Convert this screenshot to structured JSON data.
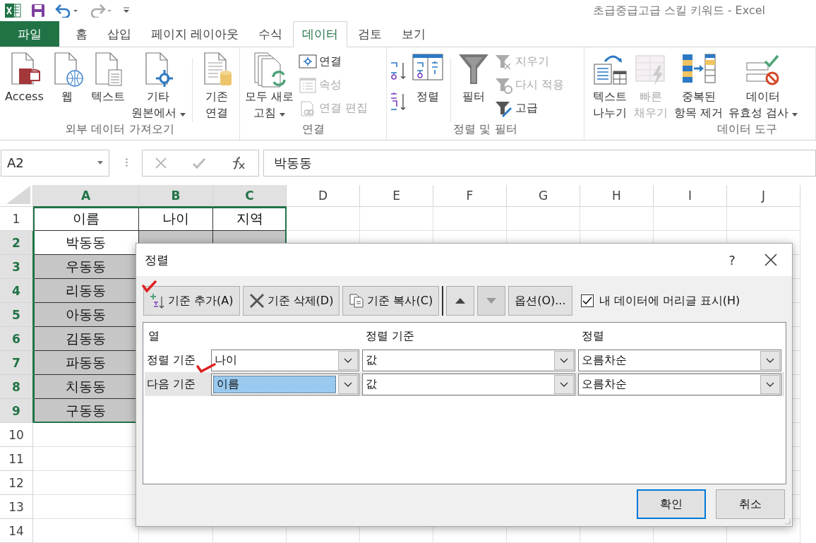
{
  "title_bar": {
    "title": "초급중급고급 스킬 키워드 - Excel"
  },
  "ribbon_tabs": [
    {
      "label": "파일",
      "kind": "file"
    },
    {
      "label": "홈",
      "kind": "tab",
      "selected": false
    },
    {
      "label": "삽입",
      "kind": "tab",
      "selected": false
    },
    {
      "label": "페이지 레이아웃",
      "kind": "tab",
      "selected": false
    },
    {
      "label": "수식",
      "kind": "tab",
      "selected": false
    },
    {
      "label": "데이터",
      "kind": "tab",
      "selected": true
    },
    {
      "label": "검토",
      "kind": "tab",
      "selected": false
    },
    {
      "label": "보기",
      "kind": "tab",
      "selected": false
    }
  ],
  "ribbon_groups": [
    {
      "label": "외부 데이터 가져오기",
      "items": [
        {
          "kind": "large",
          "lines": [
            "Access"
          ],
          "dropdown": false,
          "disabled": false
        },
        {
          "kind": "large",
          "lines": [
            "웹"
          ],
          "dropdown": false,
          "disabled": false
        },
        {
          "kind": "large",
          "lines": [
            "텍스트"
          ],
          "dropdown": false,
          "disabled": false
        },
        {
          "kind": "large",
          "lines": [
            "기타",
            "원본에서"
          ],
          "dropdown": true,
          "disabled": false
        },
        {
          "kind": "separator"
        },
        {
          "kind": "large",
          "lines": [
            "기존",
            "연결"
          ],
          "dropdown": false,
          "disabled": false
        }
      ]
    },
    {
      "label": "연결",
      "items": [
        {
          "kind": "large",
          "lines": [
            "모두 새로",
            "고침"
          ],
          "dropdown": true,
          "disabled": false
        },
        {
          "kind": "stack",
          "buttons": [
            {
              "label": "연결",
              "disabled": false
            },
            {
              "label": "속성",
              "disabled": true
            },
            {
              "label": "연결 편집",
              "disabled": true
            }
          ]
        }
      ]
    },
    {
      "label": "정렬 및 필터",
      "items": [
        {
          "kind": "icons"
        },
        {
          "kind": "large",
          "lines": [
            "정렬"
          ],
          "dropdown": false,
          "disabled": false
        },
        {
          "kind": "separator"
        },
        {
          "kind": "large",
          "lines": [
            "필터"
          ],
          "dropdown": false,
          "disabled": false
        },
        {
          "kind": "stack",
          "buttons": [
            {
              "label": "지우기",
              "disabled": true
            },
            {
              "label": "다시 적용",
              "disabled": true
            },
            {
              "label": "고급",
              "disabled": false
            }
          ]
        }
      ]
    },
    {
      "label": "데이터 도구",
      "items": [
        {
          "kind": "large",
          "lines": [
            "텍스트",
            "나누기"
          ],
          "dropdown": false,
          "disabled": false
        },
        {
          "kind": "large",
          "lines": [
            "빠른",
            "채우기"
          ],
          "dropdown": false,
          "disabled": true
        },
        {
          "kind": "large",
          "lines": [
            "중복된",
            "항목 제거"
          ],
          "dropdown": false,
          "disabled": false
        },
        {
          "kind": "large",
          "lines": [
            "데이터",
            "유효성 검사"
          ],
          "dropdown": true,
          "disabled": false
        }
      ]
    }
  ],
  "formula_bar": {
    "name_box": "A2",
    "value": "박동동"
  },
  "sheet": {
    "columns": [
      {
        "label": "A",
        "selected": true
      },
      {
        "label": "B",
        "selected": true
      },
      {
        "label": "C",
        "selected": true
      },
      {
        "label": "D",
        "selected": false
      },
      {
        "label": "E",
        "selected": false
      },
      {
        "label": "F",
        "selected": false
      },
      {
        "label": "G",
        "selected": false
      },
      {
        "label": "H",
        "selected": false
      },
      {
        "label": "I",
        "selected": false
      },
      {
        "label": "J",
        "selected": false
      }
    ],
    "rows": [
      {
        "label": "1",
        "selected": false,
        "cells": [
          {
            "text": "이름",
            "selected": false
          },
          {
            "text": "나이",
            "selected": false
          },
          {
            "text": "지역",
            "selected": false
          }
        ]
      },
      {
        "label": "2",
        "selected": true,
        "cells": [
          {
            "text": "박동동",
            "selected": false
          },
          {
            "selected": true
          },
          {
            "selected": true
          }
        ]
      },
      {
        "label": "3",
        "selected": true,
        "cells": [
          {
            "text": "우동동",
            "selected": true
          }
        ]
      },
      {
        "label": "4",
        "selected": true,
        "cells": [
          {
            "text": "리동동",
            "selected": true
          }
        ]
      },
      {
        "label": "5",
        "selected": true,
        "cells": [
          {
            "text": "아동동",
            "selected": true
          }
        ]
      },
      {
        "label": "6",
        "selected": true,
        "cells": [
          {
            "text": "김동동",
            "selected": true
          }
        ]
      },
      {
        "label": "7",
        "selected": true,
        "cells": [
          {
            "text": "파동동",
            "selected": true
          }
        ]
      },
      {
        "label": "8",
        "selected": true,
        "cells": [
          {
            "text": "치동동",
            "selected": true
          }
        ]
      },
      {
        "label": "9",
        "selected": true,
        "cells": [
          {
            "text": "구동동",
            "selected": true
          }
        ]
      },
      {
        "label": "10",
        "selected": false,
        "cells": []
      },
      {
        "label": "11",
        "selected": false,
        "cells": []
      },
      {
        "label": "12",
        "selected": false,
        "cells": []
      },
      {
        "label": "13",
        "selected": false,
        "cells": []
      },
      {
        "label": "14",
        "selected": false,
        "cells": []
      }
    ]
  },
  "dialog": {
    "title": "정렬",
    "help": "?",
    "toolbar": [
      {
        "label": "기준 추가(A)",
        "kind": "add"
      },
      {
        "label": "기준 삭제(D)",
        "kind": "delete"
      },
      {
        "label": "기준 복사(C)",
        "kind": "copy"
      },
      {
        "kind": "up",
        "disabled": false
      },
      {
        "kind": "down",
        "disabled": true
      },
      {
        "label": "옵션(O)...",
        "kind": "plain"
      }
    ],
    "header_checkbox": {
      "label": "내 데이터에 머리글 표시(H)",
      "checked": true
    },
    "headers": [
      "열",
      "정렬 기준",
      "정렬"
    ],
    "levels": [
      {
        "label": "정렬 기준",
        "column": "나이",
        "sort_on": "값",
        "order": "오름차순",
        "selected": false
      },
      {
        "label": "다음 기준",
        "column": "이름",
        "sort_on": "값",
        "order": "오름차순",
        "selected": true
      }
    ],
    "buttons": [
      "확인",
      "취소"
    ]
  }
}
